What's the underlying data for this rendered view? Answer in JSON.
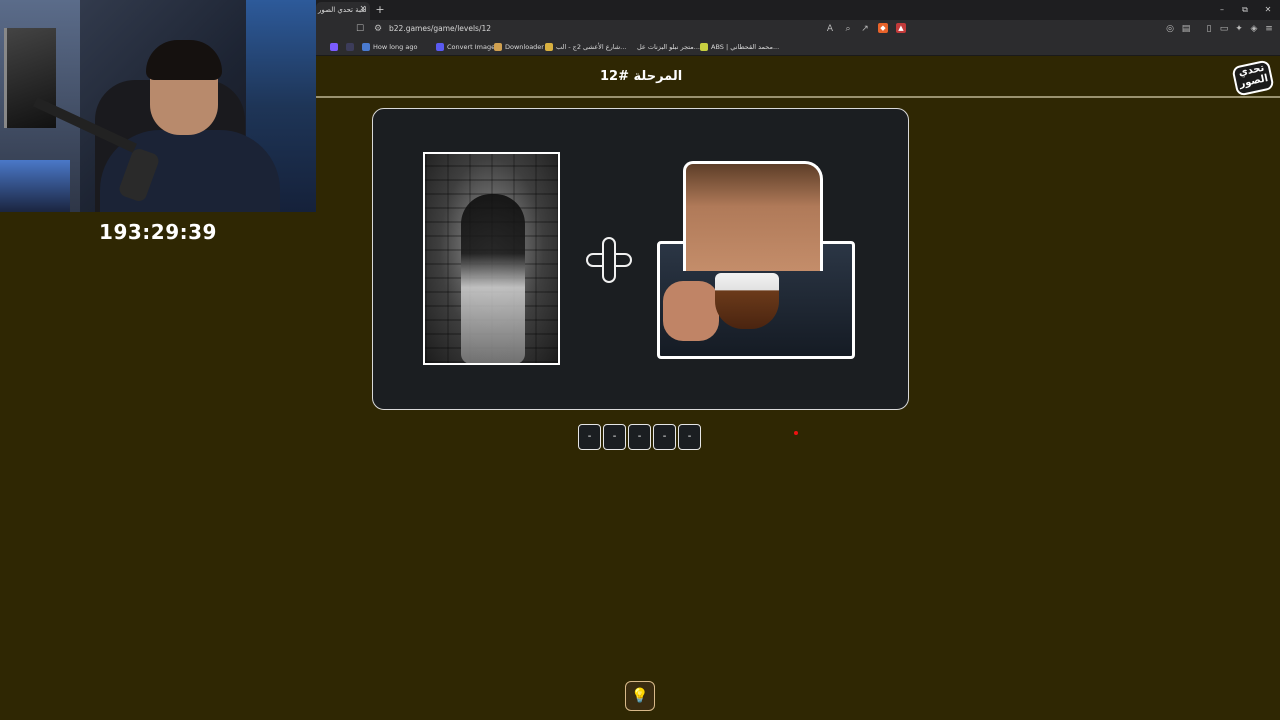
{
  "stream": {
    "timer": "193:29:39"
  },
  "browser": {
    "tab_title": "لعبة تحدي الصور",
    "tab_close": "✕",
    "new_tab": "+",
    "window_buttons": [
      "–",
      "⧉",
      "✕"
    ],
    "url": "b22.games/game/levels/12",
    "bookmarks": [
      {
        "label": "",
        "color": "#7b5cff"
      },
      {
        "label": "",
        "color": "#3c3c5a"
      },
      {
        "label": "How long ago",
        "color": "#4a7bd0"
      },
      {
        "label": "Convert Image",
        "color": "#5a5af0"
      },
      {
        "label": "Downloader",
        "color": "#d0a050"
      },
      {
        "label": "شارع الأعشى 2ج - الب...",
        "color": "#d8b040"
      },
      {
        "label": "متجر نبلو البزنات عل...",
        "color": "#2c2c2e"
      },
      {
        "label": "ABS | محمد القحطاني...",
        "color": "#c8d040"
      }
    ]
  },
  "page": {
    "level_title": "المرحلة #12",
    "logo_text": "تحدي الصور",
    "answer_slots": [
      "-",
      "-",
      "-",
      "-",
      "-"
    ],
    "hint_icon": "lightbulb-icon"
  }
}
